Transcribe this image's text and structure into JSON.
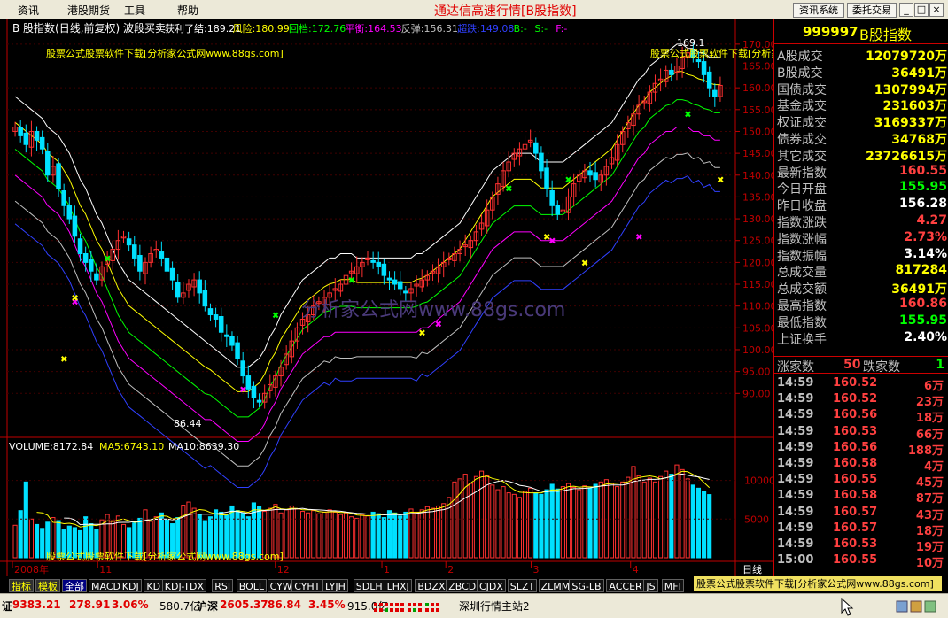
{
  "menu": [
    "资讯",
    "港股期货",
    "工具",
    "帮助"
  ],
  "app_title": "通达信高速行情[B股指数]",
  "toolbar": {
    "news_btn": "资讯系统",
    "trade_btn": "委托交易"
  },
  "window_buttons": {
    "minimize": "_",
    "maximize": "□",
    "close": "×"
  },
  "indicator_line": {
    "name": "B 股指数(日线,前复权) 波段买卖",
    "items": [
      {
        "label": "获利了结:189.21",
        "color": "#ffffff"
      },
      {
        "label": "风险:180.99",
        "color": "#ffff00"
      },
      {
        "label": "回档:172.76",
        "color": "#00ff00"
      },
      {
        "label": "平衡:164.53",
        "color": "#ff00ff"
      },
      {
        "label": "反弹:156.31",
        "color": "#c0c0c0"
      },
      {
        "label": "超跌:149.08",
        "color": "#3040ff"
      },
      {
        "label": "B:-",
        "color": "#00ff00"
      },
      {
        "label": "S:-",
        "color": "#00ff00"
      },
      {
        "label": "F:-",
        "color": "#ff00ff"
      }
    ]
  },
  "ad_text": "股票公式股票软件下载[分析家公式网www.88gs.com]",
  "ad_text_right": "股票公式股票软件下载[分析家公式网www.88gs.com]",
  "ad_text_lower": "股票公式股票软件下载[分析家公式网www.88gs.com]",
  "watermark": "分析家公式网www.88gs.com",
  "high_label": "169.1",
  "low_label": "86.44",
  "volume_line": {
    "vol": "VOLUME:8172.84",
    "ma5": "MA5:6743.10",
    "ma10": "MA10:8639.30"
  },
  "price_axis": [
    "170.00",
    "165.00",
    "160.00",
    "155.00",
    "150.00",
    "145.00",
    "140.00",
    "135.00",
    "130.00",
    "125.00",
    "120.00",
    "115.00",
    "110.00",
    "105.00",
    "100.00",
    "95.00",
    "90.00"
  ],
  "volume_axis": [
    "10000",
    "5000"
  ],
  "date_axis": [
    "2008年",
    "11",
    "12",
    "1",
    "2",
    "3",
    "4"
  ],
  "period_label": "日线",
  "chart_data": {
    "type": "candlestick",
    "ylim": [
      86,
      172
    ],
    "closes": [
      151,
      149,
      147,
      150,
      148,
      146,
      140,
      142,
      137,
      133,
      130,
      126,
      122,
      120,
      118,
      116,
      119,
      121,
      123,
      125,
      126,
      124,
      121,
      118,
      120,
      122,
      123,
      121,
      118,
      116,
      112,
      113,
      115,
      116,
      113,
      110,
      108,
      107,
      104,
      103,
      101,
      98,
      94,
      91,
      89,
      88,
      90,
      92,
      94,
      96,
      99,
      102,
      105,
      107,
      108,
      110,
      111,
      112,
      113,
      114,
      115,
      117,
      118,
      119,
      120,
      121,
      120,
      119,
      117,
      116,
      115,
      114,
      113,
      114,
      115,
      116,
      117,
      118,
      119,
      120,
      121,
      122,
      123,
      124,
      125,
      127,
      129,
      132,
      135,
      138,
      141,
      143,
      145,
      146,
      147,
      148,
      145,
      141,
      137,
      133,
      131,
      132,
      135,
      138,
      140,
      141,
      140,
      139,
      140,
      142,
      144,
      147,
      150,
      152,
      154,
      156,
      157,
      159,
      161,
      162,
      164,
      163,
      165,
      167,
      168,
      167,
      166,
      163,
      160,
      158,
      160.55
    ],
    "bands": {
      "profit": [
        158,
        157,
        156,
        155,
        154,
        153,
        151,
        150,
        149,
        147,
        145,
        142,
        139,
        137,
        134,
        131,
        129,
        126,
        123,
        120,
        118,
        116,
        115,
        114,
        113,
        112,
        111,
        110,
        109,
        108,
        107,
        106,
        105,
        104,
        103,
        102,
        101,
        100,
        99,
        98,
        97,
        96,
        96,
        96,
        97,
        98,
        100,
        103,
        105,
        108,
        110,
        112,
        114,
        116,
        117,
        118,
        119,
        120,
        121,
        121,
        122,
        122,
        122,
        121,
        121,
        121,
        121,
        121,
        121,
        121,
        121,
        121,
        121,
        121,
        122,
        122,
        123,
        124,
        125,
        126,
        127,
        128,
        129,
        131,
        133,
        135,
        137,
        139,
        141,
        142,
        143,
        144,
        145,
        145,
        145,
        145,
        144,
        143,
        143,
        143,
        143,
        143,
        144,
        145,
        146,
        147,
        148,
        149,
        150,
        151,
        152,
        154,
        156,
        158,
        160,
        162,
        163,
        165,
        166,
        167,
        168,
        169,
        170,
        170,
        169,
        169,
        168,
        168,
        167,
        167,
        167
      ],
      "balance": [
        140,
        139,
        138,
        137,
        136,
        135,
        133,
        132,
        131,
        129,
        127,
        124,
        121,
        119,
        116,
        113,
        111,
        108,
        105,
        102,
        100,
        98,
        97,
        96,
        95,
        94,
        93,
        92,
        91,
        90,
        89,
        88,
        87,
        86,
        85,
        84,
        84,
        83,
        82,
        81,
        80,
        79,
        79,
        79,
        80,
        81,
        83,
        86,
        88,
        91,
        93,
        95,
        97,
        99,
        100,
        101,
        102,
        103,
        103,
        104,
        104,
        104,
        104,
        104,
        104,
        104,
        104,
        104,
        104,
        104,
        104,
        104,
        104,
        104,
        104,
        105,
        105,
        106,
        107,
        108,
        109,
        110,
        111,
        113,
        115,
        117,
        119,
        121,
        123,
        124,
        125,
        126,
        127,
        127,
        127,
        127,
        126,
        125,
        125,
        125,
        125,
        125,
        126,
        127,
        128,
        129,
        130,
        131,
        132,
        133,
        134,
        136,
        138,
        140,
        142,
        144,
        145,
        147,
        148,
        149,
        150,
        150,
        151,
        151,
        151,
        150,
        150,
        149,
        149,
        148,
        148
      ]
    },
    "volume": [
      4200,
      6100,
      9800,
      5000,
      4300,
      3800,
      4600,
      5200,
      4800,
      3600,
      4100,
      3900,
      3500,
      5300,
      4400,
      3700,
      4900,
      5600,
      4800,
      5400,
      4300,
      3900,
      4500,
      5100,
      6200,
      4700,
      5300,
      5800,
      4900,
      4400,
      5200,
      6800,
      7200,
      6400,
      5600,
      4800,
      5300,
      6200,
      5900,
      5500,
      6700,
      6100,
      5800,
      5300,
      7100,
      6600,
      6000,
      6400,
      6900,
      5800,
      6200,
      6700,
      6300,
      6000,
      5800,
      6100,
      5700,
      5900,
      6200,
      5900,
      5600,
      5800,
      5300,
      5100,
      5600,
      5400,
      5900,
      5700,
      5200,
      6100,
      5800,
      5400,
      5900,
      6300,
      5900,
      6200,
      6600,
      6400,
      6700,
      7000,
      7800,
      9800,
      10200,
      10800,
      9600,
      10500,
      11200,
      10600,
      9400,
      8800,
      9200,
      8400,
      8200,
      7800,
      8600,
      9000,
      8400,
      8200,
      8800,
      9500,
      8900,
      9200,
      9600,
      9100,
      8800,
      9300,
      9000,
      9500,
      9800,
      10100,
      9600,
      9200,
      9800,
      10400,
      11800,
      10600,
      9800,
      10300,
      9800,
      10500,
      11200,
      10800,
      12000,
      11400,
      10200,
      9400,
      9000,
      8600,
      8172
    ]
  },
  "right_panel": {
    "code": "999997",
    "name": "B股指数",
    "rows": [
      {
        "label": "A股成交",
        "value": "12079720万",
        "color": "#ffff00"
      },
      {
        "label": "B股成交",
        "value": "36491万",
        "color": "#ffff00"
      },
      {
        "label": "国债成交",
        "value": "1307994万",
        "color": "#ffff00"
      },
      {
        "label": "基金成交",
        "value": "231603万",
        "color": "#ffff00"
      },
      {
        "label": "权证成交",
        "value": "3169337万",
        "color": "#ffff00"
      },
      {
        "label": "债券成交",
        "value": "34768万",
        "color": "#ffff00"
      },
      {
        "label": "其它成交",
        "value": "23726615万",
        "color": "#ffff00"
      },
      {
        "label": "最新指数",
        "value": "160.55",
        "color": "#ff4040"
      },
      {
        "label": "今日开盘",
        "value": "155.95",
        "color": "#00ff00"
      },
      {
        "label": "昨日收盘",
        "value": "156.28",
        "color": "#ffffff"
      },
      {
        "label": "指数涨跌",
        "value": "4.27",
        "color": "#ff4040"
      },
      {
        "label": "指数涨幅",
        "value": "2.73%",
        "color": "#ff4040"
      },
      {
        "label": "指数振幅",
        "value": "3.14%",
        "color": "#ffffff"
      },
      {
        "label": "总成交量",
        "value": "817284",
        "color": "#ffff00"
      },
      {
        "label": "总成交额",
        "value": "36491万",
        "color": "#ffff00"
      },
      {
        "label": "最高指数",
        "value": "160.86",
        "color": "#ff4040"
      },
      {
        "label": "最低指数",
        "value": "155.95",
        "color": "#00ff00"
      },
      {
        "label": "上证换手",
        "value": "2.40%",
        "color": "#ffffff"
      }
    ],
    "rise_label": "涨家数",
    "rise_count": "50",
    "fall_label": "跌家数",
    "fall_count": "1",
    "ticks": [
      {
        "t": "14:59",
        "p": "160.52",
        "v": "6万"
      },
      {
        "t": "14:59",
        "p": "160.52",
        "v": "23万"
      },
      {
        "t": "14:59",
        "p": "160.56",
        "v": "18万"
      },
      {
        "t": "14:59",
        "p": "160.53",
        "v": "66万"
      },
      {
        "t": "14:59",
        "p": "160.56",
        "v": "188万"
      },
      {
        "t": "14:59",
        "p": "160.58",
        "v": "4万"
      },
      {
        "t": "14:59",
        "p": "160.55",
        "v": "45万"
      },
      {
        "t": "14:59",
        "p": "160.58",
        "v": "87万"
      },
      {
        "t": "14:59",
        "p": "160.57",
        "v": "43万"
      },
      {
        "t": "14:59",
        "p": "160.57",
        "v": "18万"
      },
      {
        "t": "14:59",
        "p": "160.53",
        "v": "19万"
      },
      {
        "t": "15:00",
        "p": "160.55",
        "v": "10万"
      }
    ]
  },
  "tabs": [
    "指标",
    "模板",
    "全部",
    "MACD",
    "KDJ",
    "KD",
    "KDJ-TDX",
    "RSI",
    "BOLL",
    "CYW",
    "CYHT",
    "LYJH",
    "SDLH",
    "LHXJ",
    "BDZX",
    "ZBCD",
    "CJDX",
    "SLZT",
    "ZLMM",
    "SG-LB",
    "ACCER",
    "JS",
    "MFI"
  ],
  "status": {
    "sh_label": "证",
    "sh_index": "9383.21",
    "sh_change": "278.91",
    "sh_pct": "3.06%",
    "sh_amount": "580.7亿",
    "hs_label": "沪深",
    "hs_index": "2605.37",
    "hs_change": "86.84",
    "hs_pct": "3.45%",
    "hs_amount": "915.0亿",
    "server": "深圳行情主站2"
  }
}
